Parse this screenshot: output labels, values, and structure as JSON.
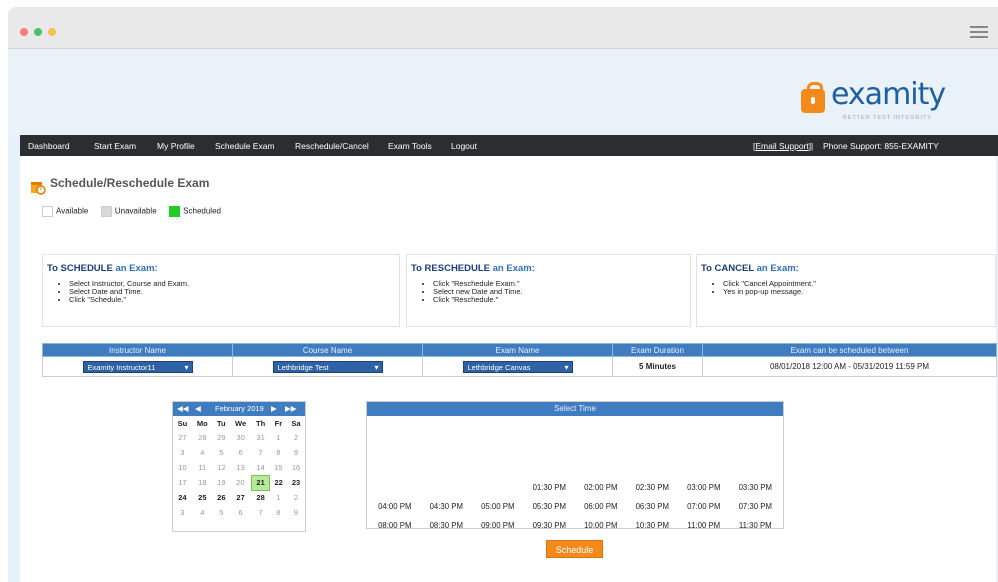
{
  "window": {
    "dots": [
      "#f57c7c",
      "#f6c24c",
      "#4bbf73"
    ]
  },
  "logo": {
    "text": "examity",
    "tagline": "BETTER TEST INTEGRITY"
  },
  "nav": {
    "items": [
      "Dashboard",
      "Start Exam",
      "My Profile",
      "Schedule Exam",
      "Reschedule/Cancel",
      "Exam Tools",
      "Logout"
    ],
    "email_support": "Email Support",
    "separator": "|",
    "phone_support": "Phone Support: 855-EXAMITY"
  },
  "page": {
    "title": "Schedule/Reschedule Exam"
  },
  "legend": [
    {
      "label": "Available",
      "color": "#ffffff"
    },
    {
      "label": "Unavailable",
      "color": "#d8d8d8"
    },
    {
      "label": "Scheduled",
      "color": "#22cc22"
    }
  ],
  "instructions": {
    "schedule": {
      "prefix": "To",
      "action": "SCHEDULE",
      "suffix": "an Exam:",
      "steps": [
        "Select Instructor, Course and Exam.",
        "Select Date and Time.",
        "Click \"Schedule.\""
      ]
    },
    "reschedule": {
      "prefix": "To",
      "action": "RESCHEDULE",
      "suffix": "an Exam:",
      "steps": [
        "Click \"Reschedule Exam.\"",
        "Select new Date and Time.",
        "Click \"Reschedule.\""
      ]
    },
    "cancel": {
      "prefix": "To",
      "action": "CANCEL",
      "suffix": "an Exam:",
      "steps": [
        "Click \"Cancel Appointment.\"",
        "Yes in pop-up message."
      ]
    }
  },
  "exam_table": {
    "headers": [
      "Instructor Name",
      "Course Name",
      "Exam Name",
      "Exam Duration",
      "Exam can be scheduled between"
    ],
    "instructor": "Examity Instructor11",
    "course": "Lethbridge Test",
    "exam": "Lethbridge Canvas",
    "duration": "5 Minutes",
    "window": "08/01/2018 12:00 AM - 05/31/2019 11:59 PM"
  },
  "calendar": {
    "month_label": "February 2019",
    "prev_year": "◀◀",
    "prev": "◀",
    "next": "▶",
    "next_year": "▶▶",
    "weekdays": [
      "Su",
      "Mo",
      "Tu",
      "We",
      "Th",
      "Fr",
      "Sa"
    ],
    "weeks": [
      [
        "27",
        "28",
        "29",
        "30",
        "31",
        "1",
        "2"
      ],
      [
        "3",
        "4",
        "5",
        "6",
        "7",
        "8",
        "9"
      ],
      [
        "10",
        "11",
        "12",
        "13",
        "14",
        "15",
        "16"
      ],
      [
        "17",
        "18",
        "19",
        "20",
        "21",
        "22",
        "23"
      ],
      [
        "24",
        "25",
        "26",
        "27",
        "28",
        "1",
        "2"
      ],
      [
        "3",
        "4",
        "5",
        "6",
        "7",
        "8",
        "9"
      ]
    ],
    "selected": "21"
  },
  "time_select": {
    "title": "Select Time",
    "visible_slots": [
      "01:30 PM",
      "02:00 PM",
      "02:30 PM",
      "03:00 PM",
      "03:30 PM",
      "04:00 PM",
      "04:30 PM",
      "05:00 PM",
      "05:30 PM",
      "06:00 PM",
      "06:30 PM",
      "07:00 PM",
      "07:30 PM",
      "08:00 PM",
      "08:30 PM",
      "09:00 PM",
      "09:30 PM",
      "10:00 PM",
      "10:30 PM",
      "11:00 PM",
      "11:30 PM"
    ]
  },
  "schedule_button": "Schedule"
}
